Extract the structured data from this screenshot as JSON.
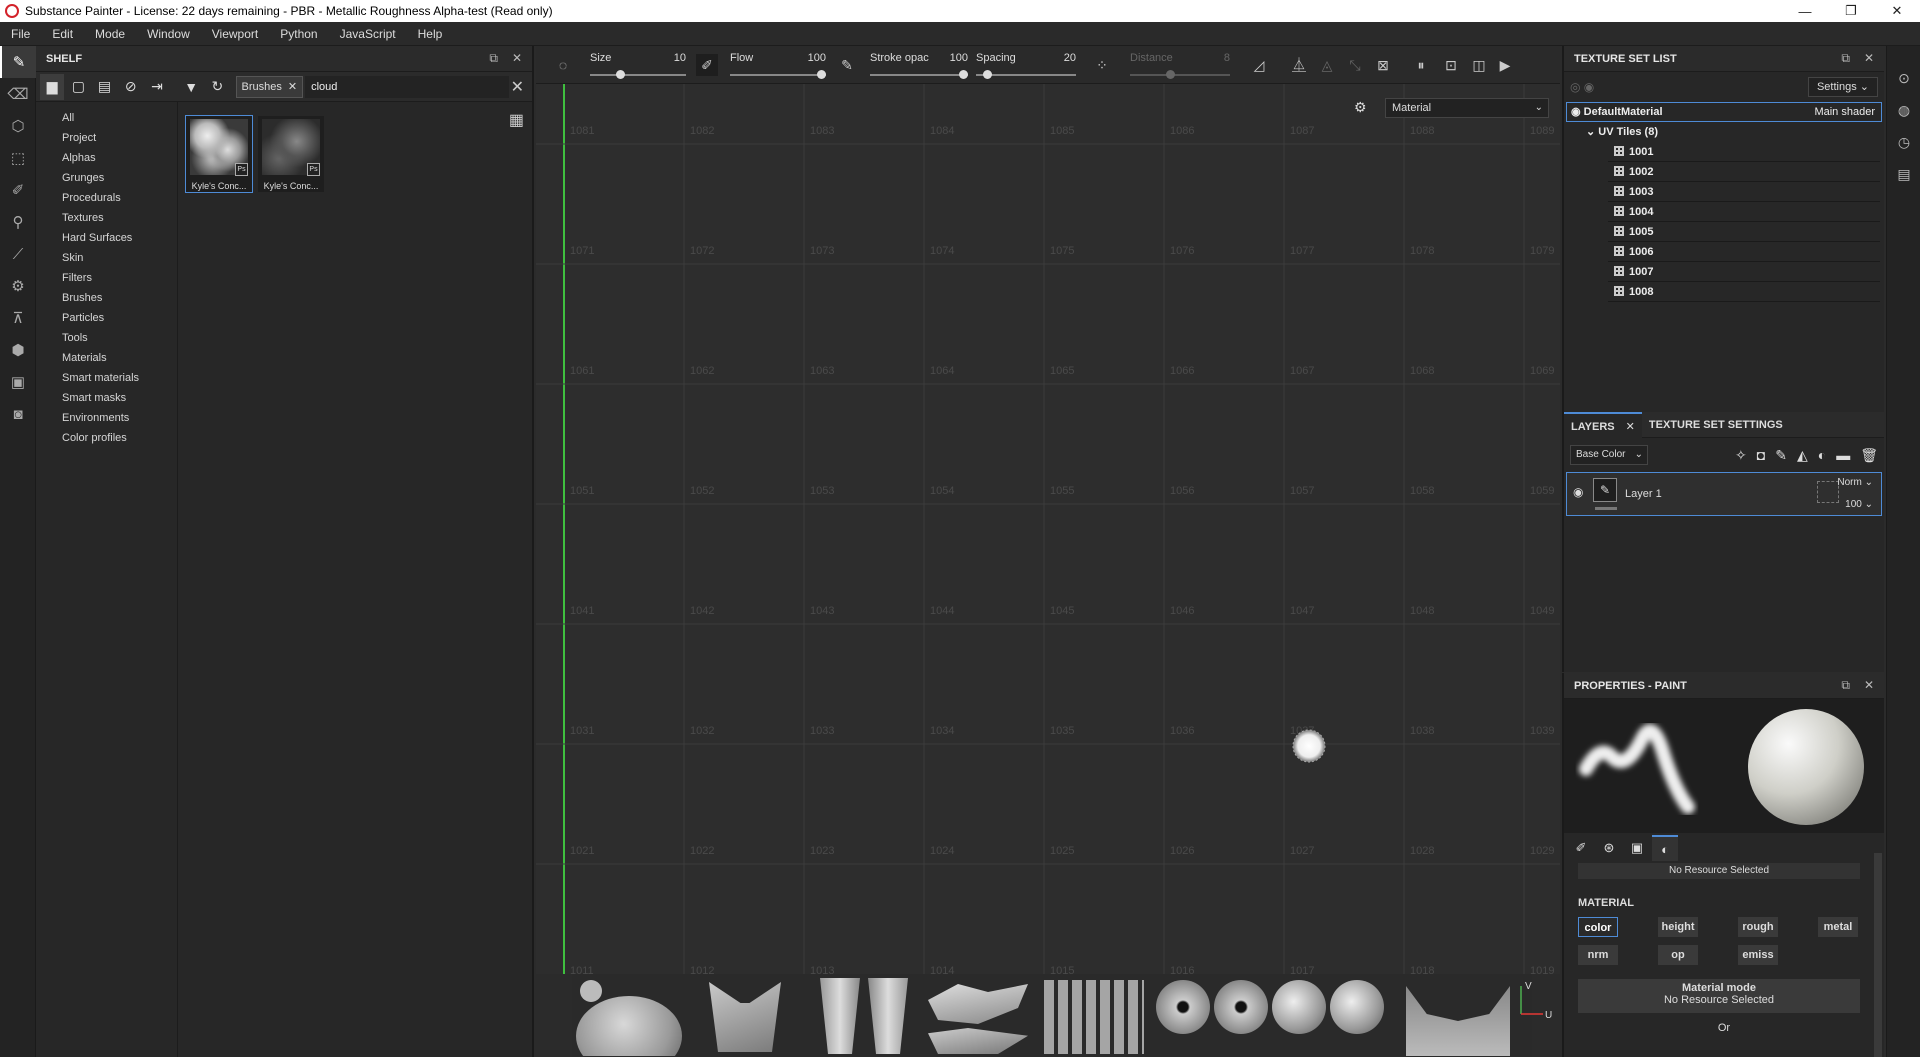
{
  "window": {
    "title": "Substance Painter - License: 22 days remaining - PBR - Metallic Roughness Alpha-test (Read only)",
    "controls": [
      "—",
      "❐",
      "✕"
    ]
  },
  "menu": [
    "File",
    "Edit",
    "Mode",
    "Window",
    "Viewport",
    "Python",
    "JavaScript",
    "Help"
  ],
  "shelf": {
    "title": "SHELF",
    "filter_chip": "Brushes",
    "search_value": "cloud",
    "categories": [
      "All",
      "Project",
      "Alphas",
      "Grunges",
      "Procedurals",
      "Textures",
      "Hard Surfaces",
      "Skin",
      "Filters",
      "Brushes",
      "Particles",
      "Tools",
      "Materials",
      "Smart materials",
      "Smart masks",
      "Environments",
      "Color profiles"
    ],
    "results": [
      {
        "label": "Kyle's Conc...",
        "badge": "Ps",
        "selected": true
      },
      {
        "label": "Kyle's Conc...",
        "badge": "Ps",
        "selected": false
      }
    ]
  },
  "toolbar": {
    "size_label": "Size",
    "size_value": "10",
    "size_fraction": 0.3,
    "flow_label": "Flow",
    "flow_value": "100",
    "flow_fraction": 1.0,
    "stroke_label": "Stroke opac",
    "stroke_value": "100",
    "stroke_fraction": 1.0,
    "spacing_label": "Spacing",
    "spacing_value": "20",
    "spacing_fraction": 0.08,
    "distance_label": "Distance",
    "distance_value": "8",
    "distance_fraction": 0.4
  },
  "viewport": {
    "display_mode": "Material",
    "uv_rows": [
      [
        "1081",
        "1082",
        "1083",
        "1084",
        "1085",
        "1086",
        "1087",
        "1088",
        "1089"
      ],
      [
        "1071",
        "1072",
        "1073",
        "1074",
        "1075",
        "1076",
        "1077",
        "1078",
        "1079"
      ],
      [
        "1061",
        "1062",
        "1063",
        "1064",
        "1065",
        "1066",
        "1067",
        "1068",
        "1069"
      ],
      [
        "1051",
        "1052",
        "1053",
        "1054",
        "1055",
        "1056",
        "1057",
        "1058",
        "1059"
      ],
      [
        "1041",
        "1042",
        "1043",
        "1044",
        "1045",
        "1046",
        "1047",
        "1048",
        "1049"
      ],
      [
        "1031",
        "1032",
        "1033",
        "1034",
        "1035",
        "1036",
        "1037",
        "1038",
        "1039"
      ],
      [
        "1021",
        "1022",
        "1023",
        "1024",
        "1025",
        "1026",
        "1027",
        "1028",
        "1029"
      ],
      [
        "1011",
        "1012",
        "1013",
        "1014",
        "1015",
        "1016",
        "1017",
        "1018",
        "1019"
      ]
    ],
    "axis_v": "V",
    "axis_u": "U"
  },
  "texture_set_list": {
    "title": "TEXTURE SET LIST",
    "settings_label": "Settings",
    "material_name": "DefaultMaterial",
    "shader_name": "Main shader",
    "uv_tiles_label": "UV Tiles (8)",
    "tiles": [
      "1001",
      "1002",
      "1003",
      "1004",
      "1005",
      "1006",
      "1007",
      "1008"
    ]
  },
  "layers": {
    "tab_layers": "LAYERS",
    "tab_settings": "TEXTURE SET SETTINGS",
    "channel": "Base Color",
    "items": [
      {
        "name": "Layer 1",
        "blend": "Norm",
        "opacity": "100"
      }
    ]
  },
  "properties": {
    "title": "PROPERTIES - PAINT",
    "no_resource_top": "No Resource Selected",
    "material_header": "MATERIAL",
    "channels_row1": [
      "color",
      "height",
      "rough",
      "metal"
    ],
    "channels_row2": [
      "nrm",
      "op",
      "emiss"
    ],
    "material_mode_label": "Material mode",
    "material_mode_value": "No Resource Selected",
    "or_label": "Or"
  }
}
